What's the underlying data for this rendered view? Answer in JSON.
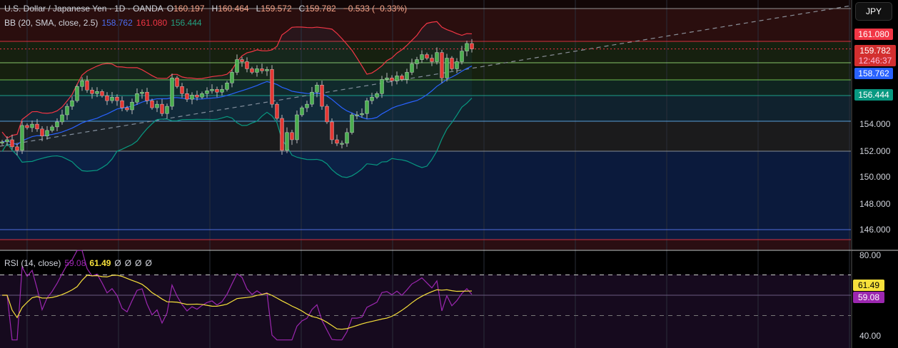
{
  "header": {
    "symbol": "U.S. Dollar / Japanese Yen · 1D · OANDA",
    "open_label": "O",
    "open": "160.197",
    "high_label": "H",
    "high": "160.464",
    "low_label": "L",
    "low": "159.572",
    "close_label": "C",
    "close": "159.782",
    "change": "−0.533 (−0.33%)"
  },
  "bb_legend": {
    "name": "BB (20, SMA, close, 2.5)",
    "basis": "158.762",
    "upper": "161.080",
    "lower": "156.444"
  },
  "rsi_legend": {
    "name": "RSI (14, close)",
    "rsi": "59.08",
    "ma": "61.49",
    "extra": [
      "Ø",
      "Ø",
      "Ø",
      "Ø"
    ]
  },
  "currency_button": "JPY",
  "price_axis": {
    "ticks": [
      "154.000",
      "152.000",
      "150.000",
      "148.000",
      "146.000"
    ],
    "tags": {
      "upper": "161.080",
      "close": "159.782",
      "countdown": "12:46:37",
      "basis": "158.762",
      "lower": "156.444"
    }
  },
  "rsi_axis": {
    "ticks": [
      "80.00",
      "40.00"
    ],
    "tags": {
      "ma": "61.49",
      "rsi": "59.08"
    }
  },
  "colors": {
    "up": "#4caf50",
    "down": "#e53935",
    "basis": "#2962ff",
    "upper": "#f23645",
    "lower": "#089981",
    "rsi": "#9c27b0",
    "rsi_ma": "#f7e13b"
  },
  "chart_data": {
    "type": "candlestick",
    "title": "U.S. Dollar / Japanese Yen · 1D · OANDA",
    "ylim": [
      145,
      162.5
    ],
    "first_open": 152.6,
    "close": [
      152.7,
      152.86,
      152.32,
      152.05,
      153.95,
      153.78,
      154.05,
      153.68,
      153.14,
      153.57,
      153.84,
      154.22,
      154.76,
      155.41,
      155.84,
      156.92,
      157.35,
      156.65,
      156.38,
      156.54,
      156.22,
      155.84,
      156.11,
      155.84,
      155.3,
      155.14,
      155.73,
      156.38,
      156.49,
      155.84,
      155.3,
      155.57,
      154.86,
      155.41,
      157.57,
      156.92,
      156.38,
      155.95,
      156.27,
      156.11,
      156.38,
      156.59,
      156.7,
      156.49,
      156.7,
      157.19,
      158.0,
      158.97,
      158.81,
      158.27,
      158.0,
      158.27,
      158.11,
      158.22,
      155.57,
      154.49,
      152.05,
      153.41,
      152.86,
      154.76,
      155.3,
      155.57,
      156.49,
      157.03,
      155.41,
      154.22,
      152.86,
      152.59,
      152.59,
      153.41,
      154.76,
      154.76,
      154.86,
      155.84,
      156.11,
      156.38,
      157.46,
      157.57,
      157.35,
      157.73,
      157.46,
      158.0,
      158.65,
      158.97,
      159.35,
      159.08,
      158.81,
      159.51,
      157.57,
      159.08,
      158.27,
      158.81,
      159.62,
      160.197,
      159.782
    ],
    "horizontal_levels": [
      161.7,
      160.1,
      158.4,
      156.2,
      154.2,
      152.0,
      146.0,
      145.2
    ],
    "bollinger": {
      "length": 20,
      "mult": 2.5,
      "basis": 158.762,
      "upper": 161.08,
      "lower": 156.444
    },
    "rsi": {
      "length": 14,
      "value": 59.08,
      "ma": 61.49,
      "ylim": [
        38,
        82
      ],
      "levels": [
        70,
        60,
        50
      ]
    }
  }
}
